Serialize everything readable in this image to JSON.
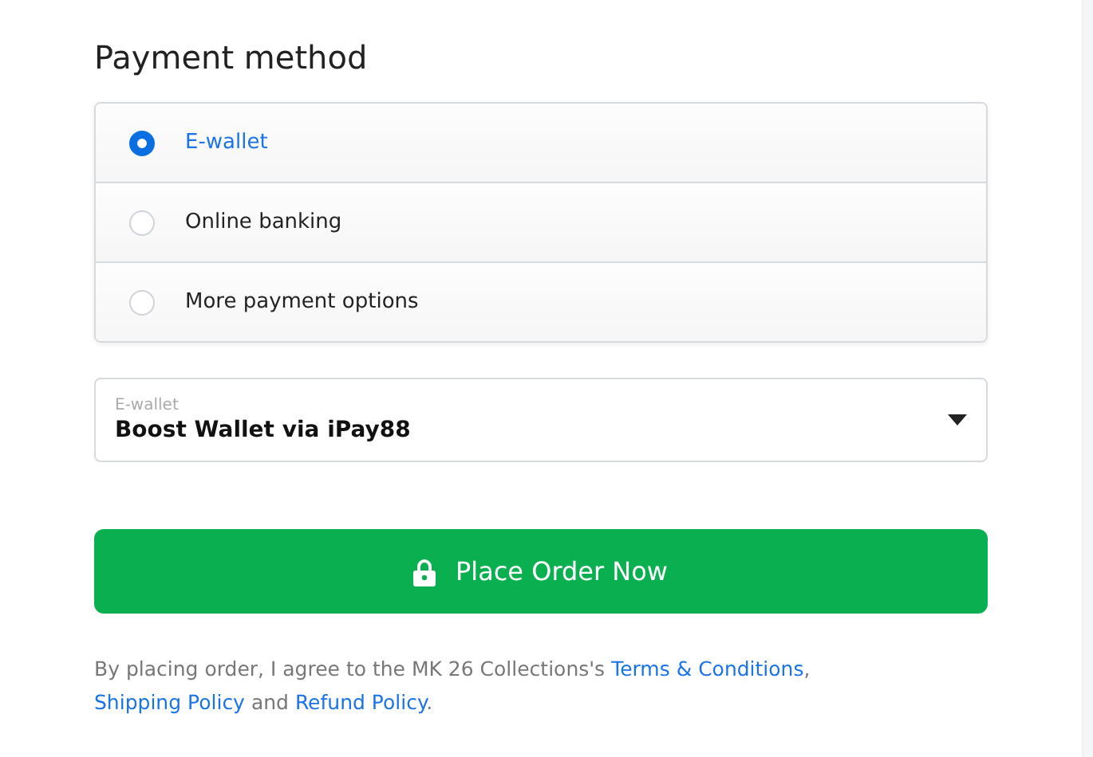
{
  "title": "Payment method",
  "options": [
    {
      "label": "E-wallet",
      "selected": true
    },
    {
      "label": "Online banking",
      "selected": false
    },
    {
      "label": "More payment options",
      "selected": false
    }
  ],
  "wallet_select": {
    "label": "E-wallet",
    "value": "Boost Wallet via iPay88"
  },
  "place_order_button": {
    "label": "Place Order Now"
  },
  "agreement": [
    {
      "kind": "text",
      "text": "By placing order, I agree to the MK 26 Collections's "
    },
    {
      "kind": "link",
      "text": "Terms & Conditions"
    },
    {
      "kind": "text",
      "text": ", "
    },
    {
      "kind": "link",
      "text": "Shipping Policy"
    },
    {
      "kind": "text",
      "text": " and "
    },
    {
      "kind": "link",
      "text": "Refund Policy"
    },
    {
      "kind": "text",
      "text": "."
    }
  ]
}
